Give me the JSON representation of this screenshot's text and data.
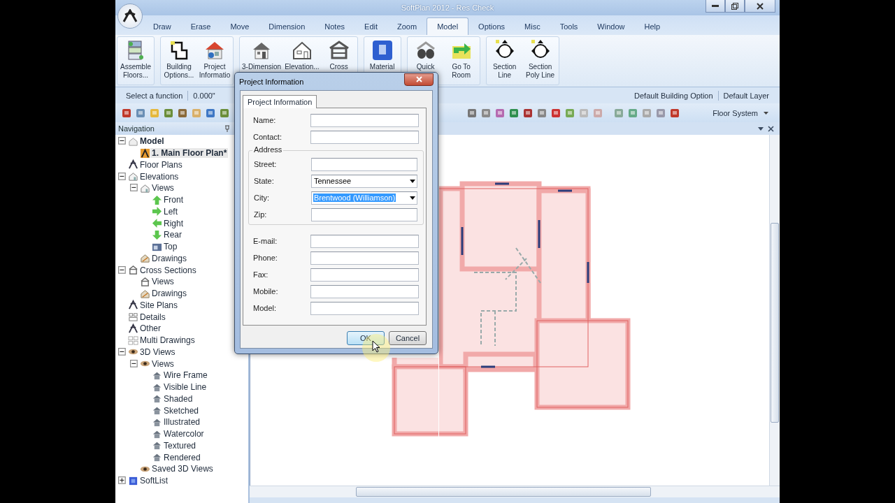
{
  "window": {
    "title": "SoftPlan 2012 - Res Check"
  },
  "menu_tabs": [
    {
      "label": "Draw",
      "selected": false
    },
    {
      "label": "Erase",
      "selected": false
    },
    {
      "label": "Move",
      "selected": false
    },
    {
      "label": "Dimension",
      "selected": false
    },
    {
      "label": "Notes",
      "selected": false
    },
    {
      "label": "Edit",
      "selected": false
    },
    {
      "label": "Zoom",
      "selected": false
    },
    {
      "label": "Model",
      "selected": true
    },
    {
      "label": "Options",
      "selected": false
    },
    {
      "label": "Misc",
      "selected": false
    },
    {
      "label": "Tools",
      "selected": false
    },
    {
      "label": "Window",
      "selected": false
    },
    {
      "label": "Help",
      "selected": false
    }
  ],
  "ribbon_groups": [
    {
      "buttons": [
        {
          "kind": "stack",
          "lines": [
            "Assemble",
            "Floors..."
          ]
        }
      ]
    },
    {
      "buttons": [
        {
          "kind": "outline",
          "lines": [
            "Building",
            "Options..."
          ]
        },
        {
          "kind": "house-red",
          "lines": [
            "Project",
            "Informatio"
          ]
        }
      ]
    },
    {
      "buttons": [
        {
          "kind": "house-gray",
          "lines": [
            "3-Dimension"
          ]
        },
        {
          "kind": "house-outline",
          "lines": [
            "Elevation..."
          ]
        },
        {
          "kind": "frame",
          "lines": [
            "Cross"
          ]
        }
      ]
    },
    {
      "buttons": [
        {
          "kind": "document",
          "lines": [
            "Material"
          ]
        }
      ]
    },
    {
      "buttons": [
        {
          "kind": "binoculars",
          "lines": [
            "Quick"
          ]
        },
        {
          "kind": "arrow",
          "lines": [
            "Go To",
            "Room"
          ]
        }
      ]
    },
    {
      "buttons": [
        {
          "kind": "marker",
          "lines": [
            "Section",
            "Line"
          ]
        },
        {
          "kind": "marker",
          "lines": [
            "Section",
            "Poly Line"
          ]
        }
      ]
    }
  ],
  "status_bar": {
    "prompt": "Select a function",
    "value": "0.000\"",
    "building_option": "Default Building Option",
    "layer": "Default Layer"
  },
  "toolbar": {
    "dropdown": "Floor System"
  },
  "navigation": {
    "title": "Navigation",
    "tree": [
      {
        "label": "Model",
        "kind": "model",
        "expanded": true,
        "selected": false,
        "children": [
          {
            "label": "1. Main Floor Plan*",
            "kind": "plan",
            "selected": true
          }
        ]
      },
      {
        "label": "Floor Plans",
        "kind": "compass",
        "selected": false
      },
      {
        "label": "Elevations",
        "kind": "house",
        "expanded": true,
        "selected": false,
        "children": [
          {
            "label": "Views",
            "kind": "house",
            "expanded": true,
            "selected": false,
            "children": [
              {
                "label": "Front",
                "kind": "arrow-up",
                "selected": false
              },
              {
                "label": "Left",
                "kind": "arrow-right",
                "selected": false
              },
              {
                "label": "Right",
                "kind": "arrow-left",
                "selected": false
              },
              {
                "label": "Rear",
                "kind": "arrow-down",
                "selected": false
              },
              {
                "label": "Top",
                "kind": "top",
                "selected": false
              }
            ]
          },
          {
            "label": "Drawings",
            "kind": "drawings",
            "selected": false
          }
        ]
      },
      {
        "label": "Cross Sections",
        "kind": "section",
        "expanded": true,
        "selected": false,
        "children": [
          {
            "label": "Views",
            "kind": "section",
            "selected": false
          },
          {
            "label": "Drawings",
            "kind": "drawings",
            "selected": false
          }
        ]
      },
      {
        "label": "Site Plans",
        "kind": "compass",
        "selected": false
      },
      {
        "label": "Details",
        "kind": "details",
        "selected": false
      },
      {
        "label": "Other",
        "kind": "compass",
        "selected": false
      },
      {
        "label": "Multi Drawings",
        "kind": "multi",
        "selected": false
      },
      {
        "label": "3D Views",
        "kind": "eye",
        "expanded": true,
        "selected": false,
        "children": [
          {
            "label": "Views",
            "kind": "eye",
            "expanded": true,
            "selected": false,
            "children": [
              {
                "label": "Wire Frame",
                "kind": "house3d",
                "selected": false
              },
              {
                "label": "Visible Line",
                "kind": "house3d",
                "selected": false
              },
              {
                "label": "Shaded",
                "kind": "house3d",
                "selected": false
              },
              {
                "label": "Sketched",
                "kind": "house3d",
                "selected": false
              },
              {
                "label": "Illustrated",
                "kind": "house3d",
                "selected": false
              },
              {
                "label": "Watercolor",
                "kind": "house3d",
                "selected": false
              },
              {
                "label": "Textured",
                "kind": "house3d",
                "selected": false
              },
              {
                "label": "Rendered",
                "kind": "house3d",
                "selected": false
              }
            ]
          },
          {
            "label": "Saved 3D Views",
            "kind": "eye",
            "selected": false
          }
        ]
      },
      {
        "label": "SoftList",
        "kind": "list",
        "expanded": false,
        "selected": false
      }
    ]
  },
  "dialog": {
    "title": "Project Information",
    "tabs": [
      {
        "label": "Project Information",
        "selected": true
      }
    ],
    "fields": [
      {
        "label": "Name:",
        "kind": "text"
      },
      {
        "label": "Contact:",
        "kind": "text"
      }
    ],
    "address": {
      "legend": "Address",
      "fields": [
        {
          "label": "Street:",
          "kind": "text"
        },
        {
          "label": "State:",
          "kind": "select",
          "value": "Tennessee",
          "highlighted": false
        },
        {
          "label": "City:",
          "kind": "select",
          "value": "Brentwood (Williamson)",
          "highlighted": true
        },
        {
          "label": "Zip:",
          "kind": "text"
        }
      ]
    },
    "more_fields": [
      {
        "label": "E-mail:",
        "kind": "text"
      },
      {
        "label": "Phone:",
        "kind": "text"
      },
      {
        "label": "Fax:",
        "kind": "text"
      },
      {
        "label": "Mobile:",
        "kind": "text"
      },
      {
        "label": "Model:",
        "kind": "text"
      }
    ],
    "buttons": [
      {
        "label": "OK",
        "focused": true
      },
      {
        "label": "Cancel",
        "focused": false
      }
    ]
  }
}
